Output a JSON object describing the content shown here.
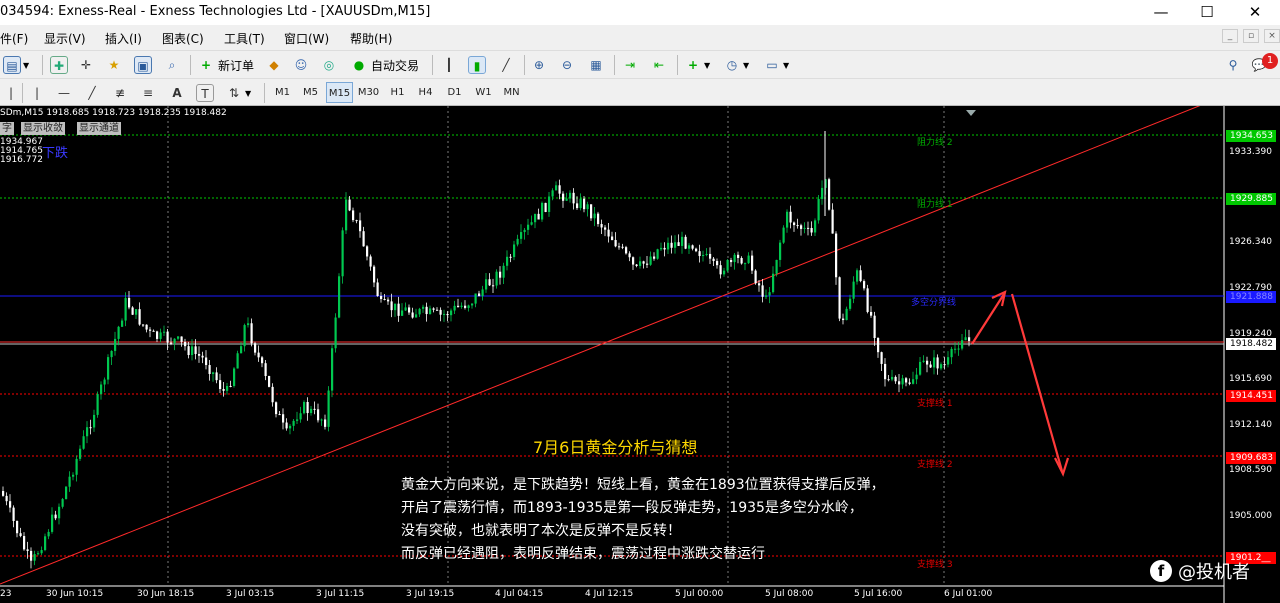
{
  "window": {
    "title": "034594: Exness-Real - Exness Technologies Ltd - [XAUUSDm,M15]",
    "min": "—",
    "max": "☐",
    "close": "✕"
  },
  "menu": [
    "件(F)",
    "显示(V)",
    "插入(I)",
    "图表(C)",
    "工具(T)",
    "窗口(W)",
    "帮助(H)"
  ],
  "toolbar": {
    "new_order": "新订单",
    "auto_trade": "自动交易",
    "notification_count": "1",
    "text_tool": "A",
    "text_label_tool": "T",
    "timeframes": [
      "M1",
      "M5",
      "M15",
      "M30",
      "H1",
      "H4",
      "D1",
      "W1",
      "MN"
    ],
    "active_timeframe": "M15"
  },
  "chart": {
    "info": "SDm,M15  1918.685 1918.723 1918.235 1918.482",
    "buttons": [
      "字",
      "显示收敛",
      "显示通道"
    ],
    "info_values": [
      "1934.967",
      "1914.765",
      "1916.772"
    ],
    "trend_label": "下跌",
    "levels": {
      "resistance2": "阻力线 2",
      "resistance1": "阻力线 1",
      "divide": "多空分界线",
      "support1": "支撑线 1",
      "support2": "支撑线 2",
      "support3": "支撑线 3"
    },
    "price_axis": [
      "1933.390",
      "1926.340",
      "1922.790",
      "1919.240",
      "1915.690",
      "1912.140",
      "1908.590",
      "1905.000"
    ],
    "price_tags": {
      "r2": "1934.653",
      "r1": "1929.885",
      "divide": "1921.888",
      "current": "1918.482",
      "s1": "1914.451",
      "s2": "1909.683",
      "s3": "1901.2__"
    },
    "time_axis": [
      "23",
      "30 Jun 10:15",
      "30 Jun 18:15",
      "3 Jul 03:15",
      "3 Jul 11:15",
      "3 Jul 19:15",
      "4 Jul 04:15",
      "4 Jul 12:15",
      "5 Jul 00:00",
      "5 Jul 08:00",
      "5 Jul 16:00",
      "6 Jul 01:00"
    ],
    "colors": {
      "bull": "#00c850",
      "bear": "#ffffff",
      "trend": "#ff2a2a",
      "resistance": "#00c800",
      "divide": "#1a1aff",
      "support": "#ff0000"
    }
  },
  "analysis": {
    "headline": "7月6日黄金分析与猜想",
    "lines": [
      "黄金大方向来说，是下跌趋势！短线上看，黄金在1893位置获得支撑后反弹，",
      "开启了震荡行情，而1893-1935是第一段反弹走势，1935是多空分水岭，",
      "没有突破，也就表明了本次是反弹不是反转！",
      "而反弹已经遇阻，表明反弹结束，震荡过程中涨跌交替运行"
    ]
  },
  "watermark": {
    "logo": "f",
    "text": "@投机者"
  }
}
